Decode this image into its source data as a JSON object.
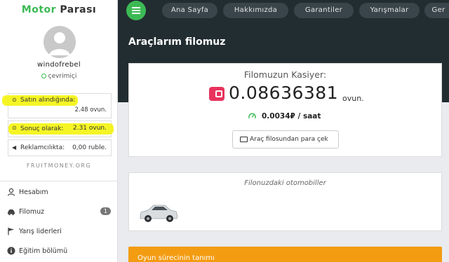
{
  "brand": {
    "part1": "Motor",
    "part2": "Parası"
  },
  "user": {
    "name": "windofrebel",
    "status": "çevrimiçi"
  },
  "stats": {
    "purchase_label": "Satın alındığında:",
    "purchase_value": "2.48 ovun.",
    "result_label": "Sonuç olarak:",
    "result_value": "2.31 ovun.",
    "ads_label": "Reklamcılıkta:",
    "ads_value": "0,00 ruble."
  },
  "site_label": "FRUITMONEY.ORG",
  "menu": [
    {
      "label": "Hesabım",
      "icon": "user-icon"
    },
    {
      "label": "Filomuz",
      "icon": "car-icon",
      "badge": "1"
    },
    {
      "label": "Yarış liderleri",
      "icon": "flag-icon"
    },
    {
      "label": "Eğitim bölümü",
      "icon": "info-icon"
    }
  ],
  "nav": [
    {
      "label": "Ana Sayfa"
    },
    {
      "label": "Hakkımızda"
    },
    {
      "label": "Garantiler"
    },
    {
      "label": "Yarışmalar"
    },
    {
      "label": "Ger"
    }
  ],
  "page": {
    "title": "Araçlarım filomuz"
  },
  "fleet": {
    "kasiyer_title": "Filomuzun Kasiyer:",
    "amount": "0.08636381",
    "amount_unit": "ovun.",
    "rate": "0.0034₽ / saat",
    "withdraw_label": "Araç filosundan para çek",
    "cars_title": "Filonuzdaki otomobiller"
  },
  "banner": {
    "label": "Oyun sürecinin tanımı"
  },
  "colors": {
    "accent": "#3cba54",
    "dark": "#222d32",
    "wallet": "#e8335d",
    "banner": "#f39c12",
    "highlight": "#f3f300"
  }
}
